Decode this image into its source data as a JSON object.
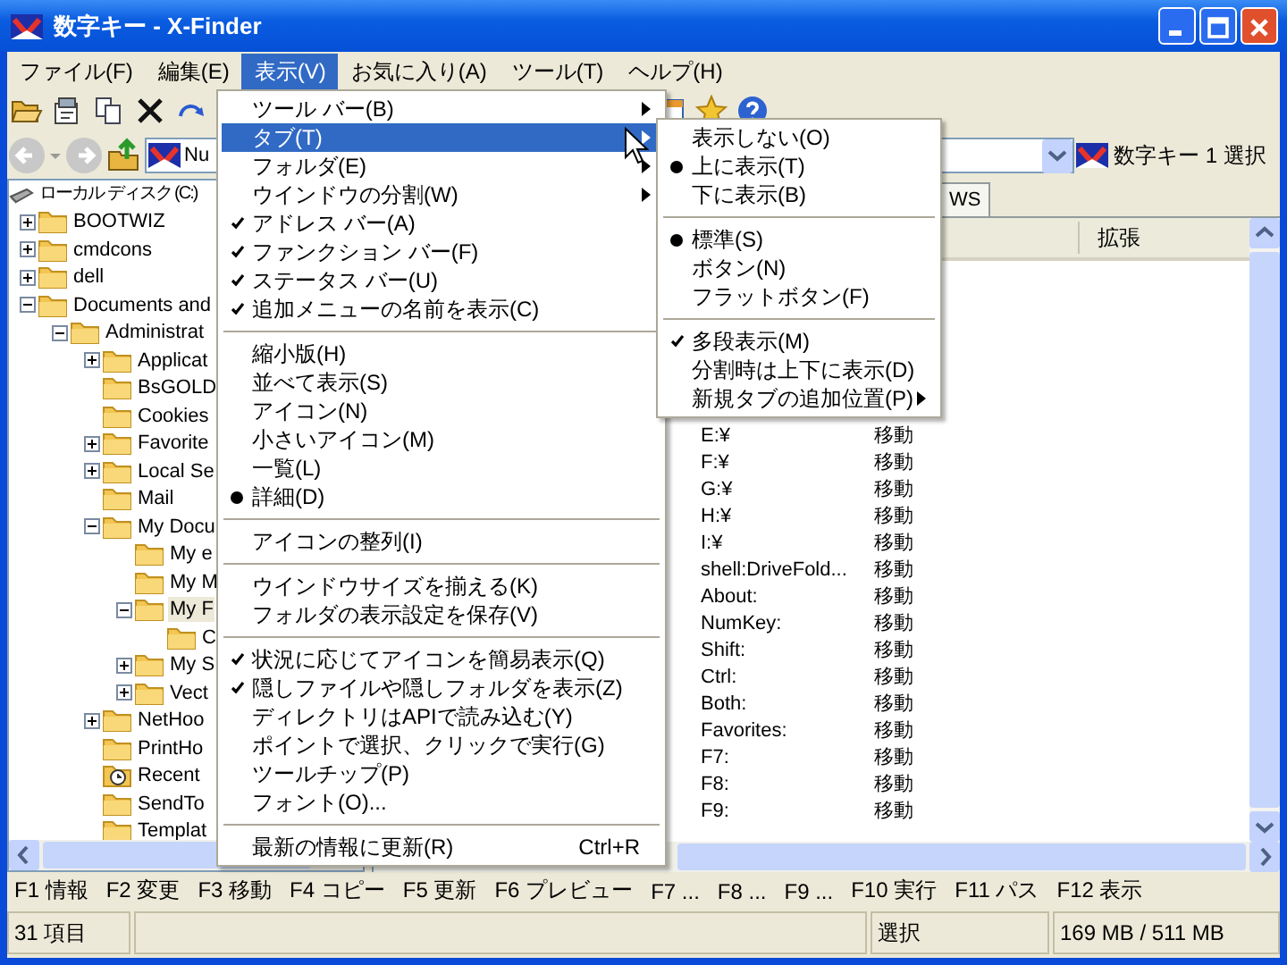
{
  "window": {
    "title": "数字キー - X-Finder"
  },
  "menubar": [
    {
      "label": "ファイル(F)",
      "selected": false
    },
    {
      "label": "編集(E)",
      "selected": false
    },
    {
      "label": "表示(V)",
      "selected": true
    },
    {
      "label": "お気に入り(A)",
      "selected": false
    },
    {
      "label": "ツール(T)",
      "selected": false
    },
    {
      "label": "ヘルプ(H)",
      "selected": false
    }
  ],
  "address": {
    "value": "Nu",
    "location": "数字キー 1 選択"
  },
  "tree": {
    "label": "ローカル ディスク (C:)",
    "kind": "drive",
    "selected": false,
    "children": [
      {
        "label": "BOOTWIZ",
        "kind": "folder",
        "expandable": true,
        "expanded": false,
        "selected": false
      },
      {
        "label": "cmdcons",
        "kind": "folder",
        "expandable": true,
        "expanded": false,
        "selected": false
      },
      {
        "label": "dell",
        "kind": "folder",
        "expandable": true,
        "expanded": false,
        "selected": false
      },
      {
        "label": "Documents and",
        "kind": "folder",
        "expandable": true,
        "expanded": true,
        "selected": false,
        "children": [
          {
            "label": "Administrat",
            "kind": "folder",
            "expandable": true,
            "expanded": true,
            "selected": false,
            "children": [
              {
                "label": "Applicat",
                "kind": "folder",
                "expandable": true,
                "expanded": false,
                "selected": false
              },
              {
                "label": "BsGOLD",
                "kind": "folder",
                "selected": false
              },
              {
                "label": "Cookies",
                "kind": "folder",
                "selected": false
              },
              {
                "label": "Favorite",
                "kind": "folder",
                "expandable": true,
                "expanded": false,
                "selected": false
              },
              {
                "label": "Local Se",
                "kind": "folder",
                "expandable": true,
                "expanded": false,
                "selected": false
              },
              {
                "label": "Mail",
                "kind": "folder",
                "selected": false
              },
              {
                "label": "My Docu",
                "kind": "folder",
                "expandable": true,
                "expanded": true,
                "selected": false,
                "children": [
                  {
                    "label": "My e",
                    "kind": "folder",
                    "selected": false
                  },
                  {
                    "label": "My M",
                    "kind": "folder",
                    "selected": false
                  },
                  {
                    "label": "My F",
                    "kind": "folder",
                    "expandable": true,
                    "expanded": true,
                    "selected": true,
                    "children": [
                      {
                        "label": "C",
                        "kind": "folder",
                        "selected": false
                      }
                    ]
                  },
                  {
                    "label": "My S",
                    "kind": "folder",
                    "expandable": true,
                    "expanded": false,
                    "selected": false
                  },
                  {
                    "label": "Vect",
                    "kind": "folder",
                    "expandable": true,
                    "expanded": false,
                    "selected": false
                  }
                ]
              },
              {
                "label": "NetHoo",
                "kind": "folder",
                "expandable": true,
                "expanded": false,
                "selected": false
              },
              {
                "label": "PrintHo",
                "kind": "folder",
                "selected": false
              },
              {
                "label": "Recent",
                "kind": "recent",
                "selected": false
              },
              {
                "label": "SendTo",
                "kind": "folder",
                "selected": false
              },
              {
                "label": "Templat",
                "kind": "folder",
                "selected": false
              }
            ]
          }
        ]
      }
    ]
  },
  "tabs": [
    {
      "label": "WS",
      "selected": false
    }
  ],
  "table": {
    "columns": [
      "拡張"
    ],
    "rows": [
      {
        "name": "E:¥",
        "action": "移動"
      },
      {
        "name": "F:¥",
        "action": "移動"
      },
      {
        "name": "G:¥",
        "action": "移動"
      },
      {
        "name": "H:¥",
        "action": "移動"
      },
      {
        "name": "I:¥",
        "action": "移動"
      },
      {
        "name": "shell:DriveFold...",
        "action": "移動"
      },
      {
        "name": "About:",
        "action": "移動"
      },
      {
        "name": "NumKey:",
        "action": "移動"
      },
      {
        "name": "Shift:",
        "action": "移動"
      },
      {
        "name": "Ctrl:",
        "action": "移動"
      },
      {
        "name": "Both:",
        "action": "移動"
      },
      {
        "name": "Favorites:",
        "action": "移動"
      },
      {
        "name": "F7:",
        "action": "移動"
      },
      {
        "name": "F8:",
        "action": "移動"
      },
      {
        "name": "F9:",
        "action": "移動"
      }
    ]
  },
  "function_keys": [
    "F1 情報",
    "F2 変更",
    "F3 移動",
    "F4 コピー",
    "F5 更新",
    "F6 プレビュー",
    "F7 ...",
    "F8 ...",
    "F9 ...",
    "F10 実行",
    "F11 パス",
    "F12 表示"
  ],
  "status_bar": {
    "items": "31 項目",
    "selection": "選択",
    "memory": "169 MB / 511 MB"
  },
  "view_menu": {
    "items": [
      {
        "kind": "check",
        "label": "ツール バー(B)",
        "checked": false,
        "selected": false,
        "submenu": true
      },
      {
        "kind": "check",
        "label": "タブ(T)",
        "checked": false,
        "selected": true,
        "submenu": true
      },
      {
        "kind": "check",
        "label": "フォルダ(E)",
        "checked": false,
        "selected": false,
        "submenu": true
      },
      {
        "kind": "check",
        "label": "ウインドウの分割(W)",
        "checked": false,
        "selected": false,
        "submenu": true
      },
      {
        "kind": "check",
        "label": "アドレス バー(A)",
        "checked": true,
        "selected": false
      },
      {
        "kind": "check",
        "label": "ファンクション バー(F)",
        "checked": true,
        "selected": false
      },
      {
        "kind": "check",
        "label": "ステータス バー(U)",
        "checked": true,
        "selected": false
      },
      {
        "kind": "check",
        "label": "追加メニューの名前を表示(C)",
        "checked": true,
        "selected": false
      },
      {
        "kind": "separator"
      },
      {
        "kind": "radio",
        "label": "縮小版(H)",
        "checked": false,
        "selected": false
      },
      {
        "kind": "radio",
        "label": "並べて表示(S)",
        "checked": false,
        "selected": false
      },
      {
        "kind": "radio",
        "label": "アイコン(N)",
        "checked": false,
        "selected": false
      },
      {
        "kind": "radio",
        "label": "小さいアイコン(M)",
        "checked": false,
        "selected": false
      },
      {
        "kind": "radio",
        "label": "一覧(L)",
        "checked": false,
        "selected": false
      },
      {
        "kind": "radio",
        "label": "詳細(D)",
        "checked": true,
        "selected": false
      },
      {
        "kind": "separator"
      },
      {
        "kind": "check",
        "label": "アイコンの整列(I)",
        "checked": false,
        "selected": false
      },
      {
        "kind": "separator"
      },
      {
        "kind": "check",
        "label": "ウインドウサイズを揃える(K)",
        "checked": false,
        "selected": false
      },
      {
        "kind": "check",
        "label": "フォルダの表示設定を保存(V)",
        "checked": false,
        "selected": false
      },
      {
        "kind": "separator"
      },
      {
        "kind": "check",
        "label": "状況に応じてアイコンを簡易表示(Q)",
        "checked": true,
        "selected": false
      },
      {
        "kind": "check",
        "label": "隠しファイルや隠しフォルダを表示(Z)",
        "checked": true,
        "selected": false
      },
      {
        "kind": "check",
        "label": "ディレクトリはAPIで読み込む(Y)",
        "checked": false,
        "selected": false
      },
      {
        "kind": "check",
        "label": "ポイントで選択、クリックで実行(G)",
        "checked": false,
        "selected": false
      },
      {
        "kind": "check",
        "label": "ツールチップ(P)",
        "checked": false,
        "selected": false
      },
      {
        "kind": "check",
        "label": "フォント(O)...",
        "checked": false,
        "selected": false
      },
      {
        "kind": "separator"
      },
      {
        "kind": "check",
        "label": "最新の情報に更新(R)",
        "checked": false,
        "selected": false,
        "shortcut": "Ctrl+R"
      }
    ]
  },
  "tab_submenu": {
    "items": [
      {
        "kind": "radio",
        "label": "表示しない(O)",
        "checked": false,
        "selected": false
      },
      {
        "kind": "radio",
        "label": "上に表示(T)",
        "checked": true,
        "selected": false
      },
      {
        "kind": "radio",
        "label": "下に表示(B)",
        "checked": false,
        "selected": false
      },
      {
        "kind": "separator"
      },
      {
        "kind": "radio",
        "label": "標準(S)",
        "checked": true,
        "selected": false
      },
      {
        "kind": "radio",
        "label": "ボタン(N)",
        "checked": false,
        "selected": false
      },
      {
        "kind": "radio",
        "label": "フラットボタン(F)",
        "checked": false,
        "selected": false
      },
      {
        "kind": "separator"
      },
      {
        "kind": "check",
        "label": "多段表示(M)",
        "checked": true,
        "selected": false
      },
      {
        "kind": "check",
        "label": "分割時は上下に表示(D)",
        "checked": false,
        "selected": false
      },
      {
        "kind": "check",
        "label": "新規タブの追加位置(P)",
        "checked": false,
        "selected": false,
        "submenu": true
      }
    ]
  }
}
